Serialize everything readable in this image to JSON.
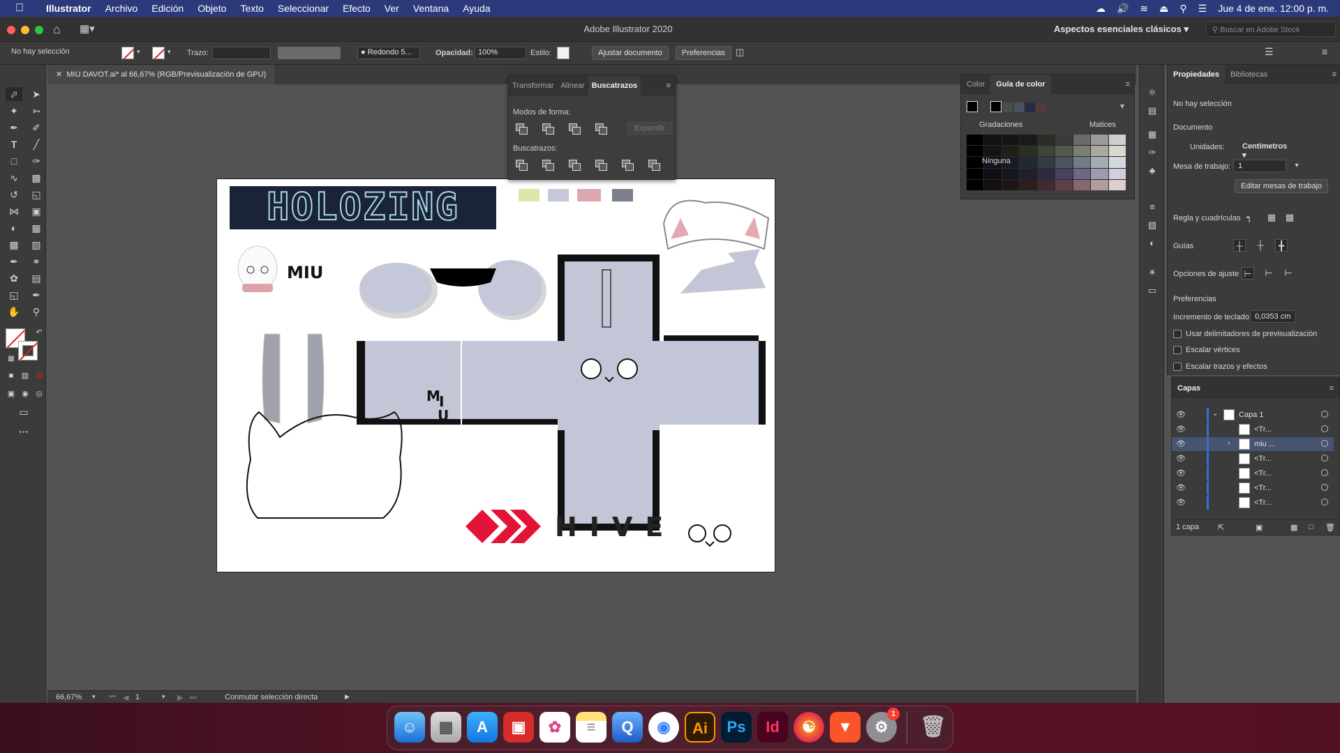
{
  "menubar": {
    "app": "Illustrator",
    "items": [
      "Archivo",
      "Edición",
      "Objeto",
      "Texto",
      "Seleccionar",
      "Efecto",
      "Ver",
      "Ventana",
      "Ayuda"
    ],
    "datetime": "Jue 4 de ene.  12:00 p. m."
  },
  "titlebar": {
    "title": "Adobe Illustrator 2020",
    "workspace": "Aspectos esenciales clásicos",
    "search_placeholder": "Buscar en Adobe Stock"
  },
  "controlbar": {
    "selection": "No hay selección",
    "stroke_label": "Trazo:",
    "brush": "Redondo 5...",
    "opacity_label": "Opacidad:",
    "opacity_value": "100%",
    "style_label": "Estilo:",
    "fit_button": "Ajustar documento",
    "prefs_button": "Preferencias"
  },
  "document": {
    "tab": "MIU DAVOT.ai* al 66,67% (RGB/Previsualización de GPU)"
  },
  "artboard": {
    "banner": "HOLOZING",
    "miu_label": "MIU",
    "box_text_1": "M",
    "box_text_2": "I",
    "box_text_3": "U",
    "hive": "HIVE",
    "swatches": [
      "#d9e8a8",
      "#c5c8d8",
      "#dca7ae",
      "#7c7f8c"
    ],
    "box_color": "#c2c6d6"
  },
  "pathfinder": {
    "tabs": [
      "Transformar",
      "Alinear",
      "Buscatrazos"
    ],
    "shape_modes": "Modos de forma:",
    "expand": "Expandir",
    "pathfinders": "Buscatrazos:"
  },
  "color_guide": {
    "tabs": [
      "Color",
      "Guía de color"
    ],
    "variations": "Gradaciones",
    "hues": "Matices",
    "none": "Ninguna"
  },
  "properties": {
    "tabs": [
      "Propiedades",
      "Bibliotecas"
    ],
    "no_selection": "No hay selección",
    "document": "Documento",
    "units_label": "Unidades:",
    "units_value": "Centímetros",
    "artboard_label": "Mesa de trabajo:",
    "artboard_value": "1",
    "edit_artboards": "Editar mesas de trabajo",
    "rulers": "Regla y cuadrículas",
    "guides": "Guías",
    "snap": "Opciones de ajuste",
    "prefs": "Preferencias",
    "keyboard_inc_label": "Incremento de teclado:",
    "keyboard_inc_value": "0,0353 cm",
    "chk1": "Usar delimitadores de previsualización",
    "chk2": "Escalar vértices",
    "chk3": "Escalar trazos y efectos"
  },
  "layers": {
    "title": "Capas",
    "rows": [
      "Capa 1",
      "<Tr...",
      "miu ...",
      "<Tr...",
      "<Tr...",
      "<Tr...",
      "<Tr..."
    ],
    "footer": "1 capa"
  },
  "statusbar": {
    "zoom": "66,67%",
    "artboard": "1",
    "tool": "Conmutar selección directa"
  },
  "dock": {
    "apps": [
      "Finder",
      "Launchpad",
      "App Store",
      "Photo Booth",
      "Fotos",
      "Notas",
      "QuickTime",
      "Chrome",
      "Ai",
      "Ps",
      "Id",
      "Firefox",
      "Brave",
      "Preferencias",
      "Papelera"
    ],
    "badge": "1"
  }
}
